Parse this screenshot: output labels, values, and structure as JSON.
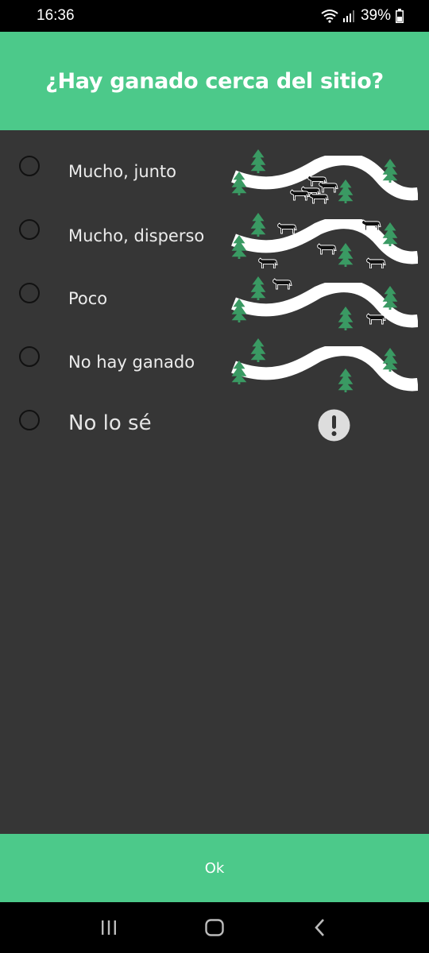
{
  "status_bar": {
    "time": "16:36",
    "battery": "39%",
    "icons": [
      "wifi-icon",
      "signal-icon",
      "battery-icon"
    ]
  },
  "header": {
    "title": "¿Hay ganado cerca del sitio?"
  },
  "options": [
    {
      "label": "Mucho, junto",
      "illustration": "river-trees-many-cattle-grouped"
    },
    {
      "label": "Mucho, disperso",
      "illustration": "river-trees-many-cattle-scattered"
    },
    {
      "label": "Poco",
      "illustration": "river-trees-few-cattle"
    },
    {
      "label": "No hay ganado",
      "illustration": "river-trees-no-cattle"
    },
    {
      "label": "No lo sé",
      "illustration": "exclamation-icon"
    }
  ],
  "footer": {
    "ok_label": "Ok"
  },
  "nav": {
    "icons": [
      "recent-apps-icon",
      "home-icon",
      "back-icon"
    ]
  },
  "colors": {
    "accent": "#4cc98a",
    "background": "#363636",
    "tree": "#3a9a63",
    "river": "#ffffff"
  }
}
